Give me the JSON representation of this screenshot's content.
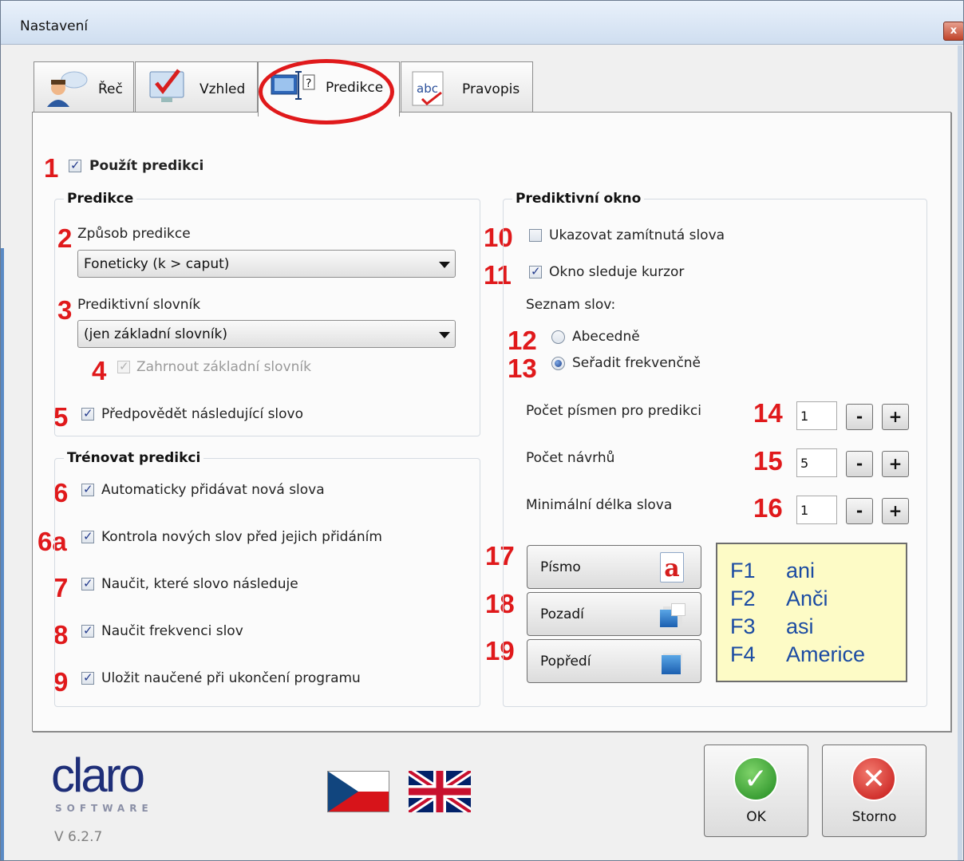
{
  "window": {
    "title": "Nastavení",
    "close_symbol": "x"
  },
  "tabs": [
    {
      "label": "Řeč",
      "icon": "speech-person-icon"
    },
    {
      "label": "Vzhled",
      "icon": "monitor-check-icon"
    },
    {
      "label": "Predikce",
      "icon": "prediction-icon",
      "active": true
    },
    {
      "label": "Pravopis",
      "icon": "spelling-abc-icon"
    }
  ],
  "markers": [
    "1",
    "2",
    "3",
    "4",
    "5",
    "6",
    "6a",
    "7",
    "8",
    "9",
    "10",
    "11",
    "12",
    "13",
    "14",
    "15",
    "16",
    "17",
    "18",
    "19"
  ],
  "use_prediction": {
    "label": "Použít predikci",
    "checked": true
  },
  "predikce_group": {
    "title": "Predikce",
    "method_label": "Způsob predikce",
    "method_value": "Foneticky (k > caput)",
    "dict_label": "Prediktivní slovník",
    "dict_value": "(jen základní slovník)",
    "include_base": {
      "label": "Zahrnout základní slovník",
      "checked": true,
      "disabled": true
    },
    "predict_next": {
      "label": "Předpovědět následující slovo",
      "checked": true
    }
  },
  "train_group": {
    "title": "Trénovat predikci",
    "items": [
      {
        "label": "Automaticky přidávat nová slova",
        "checked": true
      },
      {
        "label": "Kontrola nových slov před jejich přidáním",
        "checked": true
      },
      {
        "label": "Naučit, které slovo následuje",
        "checked": true
      },
      {
        "label": "Naučit frekvenci slov",
        "checked": true
      },
      {
        "label": "Uložit naučené při ukončení programu",
        "checked": true
      }
    ]
  },
  "window_group": {
    "title": "Prediktivní okno",
    "show_rejected": {
      "label": "Ukazovat zamítnutá slova",
      "checked": false
    },
    "follow_cursor": {
      "label": "Okno sleduje kurzor",
      "checked": true
    },
    "list_label": "Seznam slov:",
    "sort_alpha": {
      "label": "Abecedně",
      "selected": false
    },
    "sort_freq": {
      "label": "Seřadit frekvenčně",
      "selected": true
    },
    "letters_label": "Počet písmen pro predikci",
    "letters_value": "1",
    "suggestions_label": "Počet návrhů",
    "suggestions_value": "5",
    "minlen_label": "Minimální délka slova",
    "minlen_value": "1",
    "minus": "-",
    "plus": "+",
    "font_button": "Písmo",
    "font_icon_glyph": "a",
    "background_button": "Pozadí",
    "foreground_button": "Popředí"
  },
  "preview": [
    {
      "key": "F1",
      "word": "ani"
    },
    {
      "key": "F2",
      "word": "Anči"
    },
    {
      "key": "F3",
      "word": "asi"
    },
    {
      "key": "F4",
      "word": "Americe"
    }
  ],
  "footer": {
    "logo": "claro",
    "logo_sub": "SOFTWARE",
    "version": "V 6.2.7",
    "ok": "OK",
    "cancel": "Storno",
    "ok_glyph": "✓",
    "cancel_glyph": "✕"
  },
  "colors": {
    "marker": "#e0191b",
    "accent": "#1b4ba2",
    "preview_bg": "#fdfbc6"
  }
}
